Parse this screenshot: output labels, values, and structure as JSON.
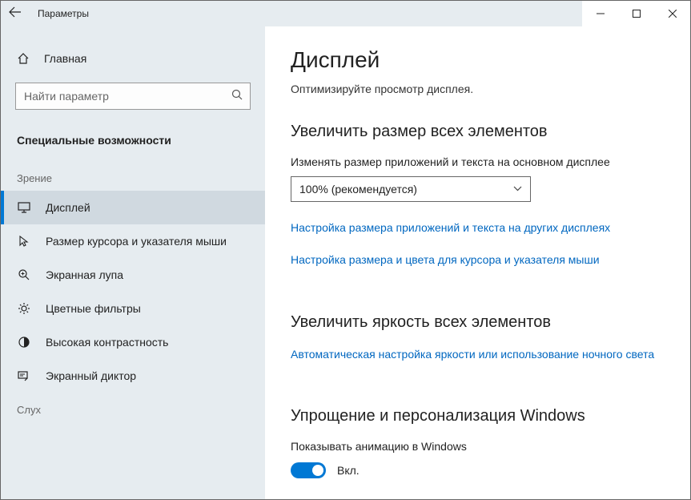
{
  "window": {
    "title": "Параметры"
  },
  "sidebar": {
    "home": "Главная",
    "search_placeholder": "Найти параметр",
    "category": "Специальные возможности",
    "groups": [
      {
        "label": "Зрение"
      },
      {
        "label": "Слух"
      }
    ],
    "items": [
      {
        "label": "Дисплей",
        "selected": true
      },
      {
        "label": "Размер курсора и указателя мыши",
        "selected": false
      },
      {
        "label": "Экранная лупа",
        "selected": false
      },
      {
        "label": "Цветные фильтры",
        "selected": false
      },
      {
        "label": "Высокая контрастность",
        "selected": false
      },
      {
        "label": "Экранный диктор",
        "selected": false
      }
    ]
  },
  "content": {
    "title": "Дисплей",
    "subtitle": "Оптимизируйте просмотр дисплея.",
    "section1": {
      "heading": "Увеличить размер всех элементов",
      "scale_label": "Изменять размер приложений и текста на основном дисплее",
      "scale_value": "100% (рекомендуется)",
      "link1": "Настройка размера приложений и текста на других дисплеях",
      "link2": "Настройка размера и цвета для курсора и указателя мыши"
    },
    "section2": {
      "heading": "Увеличить яркость всех элементов",
      "link1": "Автоматическая настройка яркости или использование ночного света"
    },
    "section3": {
      "heading": "Упрощение и персонализация Windows",
      "toggle_label": "Показывать анимацию в Windows",
      "toggle_state": "Вкл."
    }
  }
}
